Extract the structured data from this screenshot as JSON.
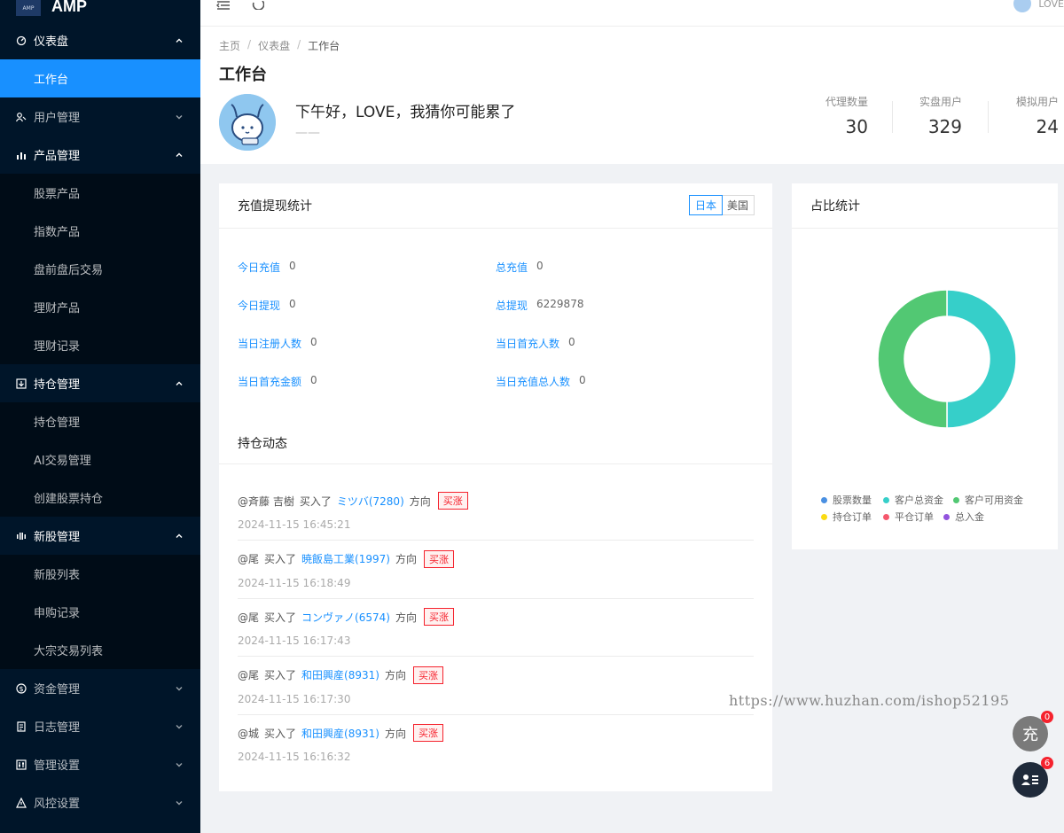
{
  "app": {
    "logo_small": "AMP",
    "title": "AMP"
  },
  "sidebar": {
    "groups": [
      {
        "label": "仪表盘",
        "icon": "dashboard-icon",
        "expanded": true,
        "items": [
          {
            "label": "工作台",
            "active": true
          }
        ]
      },
      {
        "label": "用户管理",
        "icon": "users-icon",
        "expanded": false,
        "items": []
      },
      {
        "label": "产品管理",
        "icon": "chart-icon",
        "expanded": true,
        "items": [
          {
            "label": "股票产品"
          },
          {
            "label": "指数产品"
          },
          {
            "label": "盘前盘后交易"
          },
          {
            "label": "理财产品"
          },
          {
            "label": "理财记录"
          }
        ]
      },
      {
        "label": "持仓管理",
        "icon": "download-box-icon",
        "expanded": true,
        "items": [
          {
            "label": "持仓管理"
          },
          {
            "label": "AI交易管理"
          },
          {
            "label": "创建股票持仓"
          }
        ]
      },
      {
        "label": "新股管理",
        "icon": "signal-icon",
        "expanded": true,
        "items": [
          {
            "label": "新股列表"
          },
          {
            "label": "申购记录"
          },
          {
            "label": "大宗交易列表"
          }
        ]
      },
      {
        "label": "资金管理",
        "icon": "dollar-icon",
        "expanded": false,
        "items": []
      },
      {
        "label": "日志管理",
        "icon": "log-icon",
        "expanded": false,
        "items": []
      },
      {
        "label": "管理设置",
        "icon": "settings-icon",
        "expanded": false,
        "items": []
      },
      {
        "label": "风控设置",
        "icon": "warning-icon",
        "expanded": false,
        "items": []
      }
    ]
  },
  "header": {
    "user_name": "LOVE"
  },
  "breadcrumb": [
    "主页",
    "仪表盘",
    "工作台"
  ],
  "page": {
    "title": "工作台",
    "greeting": "下午好，LOVE，我猜你可能累了",
    "greeting_sub": "——",
    "stats": [
      {
        "label": "代理数量",
        "value": "30"
      },
      {
        "label": "实盘用户",
        "value": "329"
      },
      {
        "label": "模拟用户",
        "value": "24"
      }
    ]
  },
  "recharge": {
    "title": "充值提现统计",
    "tabs": [
      {
        "label": "日本",
        "active": true
      },
      {
        "label": "美国",
        "active": false
      }
    ],
    "rows": [
      {
        "label": "今日充值",
        "value": "0"
      },
      {
        "label": "总充值",
        "value": "0"
      },
      {
        "label": "今日提现",
        "value": "0"
      },
      {
        "label": "总提现",
        "value": "6229878"
      },
      {
        "label": "当日注册人数",
        "value": "0"
      },
      {
        "label": "当日首充人数",
        "value": "0"
      },
      {
        "label": "当日首充金额",
        "value": "0"
      },
      {
        "label": "当日充值总人数",
        "value": "0"
      }
    ]
  },
  "feed": {
    "title": "持仓动态",
    "items": [
      {
        "user": "@斉藤 吉樹",
        "action": "买入了",
        "stock": "ミツバ(7280)",
        "dir_label": "方向",
        "tag": "买涨",
        "time": "2024-11-15 16:45:21"
      },
      {
        "user": "@尾",
        "action": "买入了",
        "stock": "暁飯島工業(1997)",
        "dir_label": "方向",
        "tag": "买涨",
        "time": "2024-11-15 16:18:49"
      },
      {
        "user": "@尾",
        "action": "买入了",
        "stock": "コンヴァノ(6574)",
        "dir_label": "方向",
        "tag": "买涨",
        "time": "2024-11-15 16:17:43"
      },
      {
        "user": "@尾",
        "action": "买入了",
        "stock": "和田興産(8931)",
        "dir_label": "方向",
        "tag": "买涨",
        "time": "2024-11-15 16:17:30"
      },
      {
        "user": "@城",
        "action": "买入了",
        "stock": "和田興産(8931)",
        "dir_label": "方向",
        "tag": "买涨",
        "time": "2024-11-15 16:16:32"
      }
    ]
  },
  "ratio": {
    "title": "占比统计",
    "chart_data": {
      "type": "pie",
      "donut": true,
      "series": [
        {
          "name": "股票数量",
          "value": 0,
          "color": "#4a90e2"
        },
        {
          "name": "客户总资金",
          "value": 50,
          "color": "#36cfc9"
        },
        {
          "name": "客户可用资金",
          "value": 50,
          "color": "#52c873"
        },
        {
          "name": "持仓订单",
          "value": 0,
          "color": "#fadb14"
        },
        {
          "name": "平仓订单",
          "value": 0,
          "color": "#f5576c"
        },
        {
          "name": "总入金",
          "value": 0,
          "color": "#9254de"
        }
      ]
    }
  },
  "watermark": "https://www.huzhan.com/ishop52195",
  "fab": [
    {
      "label": "充",
      "badge": "0"
    },
    {
      "label": "",
      "badge": "6"
    }
  ]
}
